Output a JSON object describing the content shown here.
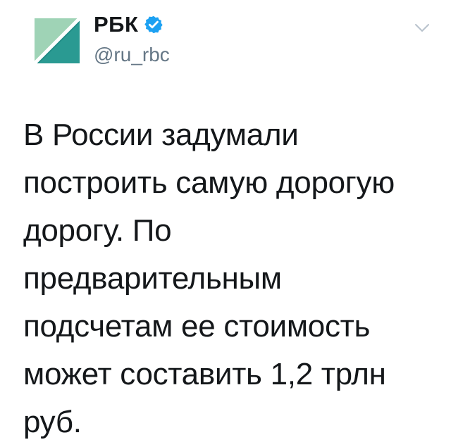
{
  "tweet": {
    "author": {
      "display_name": "РБК",
      "handle": "@ru_rbc",
      "verified": true,
      "avatar_icon": "rbc-logo-icon",
      "brand_colors": {
        "green_light": "#8cc9a8",
        "green_dark": "#1c8c83",
        "teal": "#2b9a94"
      }
    },
    "menu_icon": "chevron-down-icon",
    "verified_color": "#1da1f2",
    "text": "В России задумали\nпостроить самую дорогую\nдорогу. По\nпредварительным\nподсчетам ее стоимость\nможет составить 1,2 трлн\nруб."
  }
}
